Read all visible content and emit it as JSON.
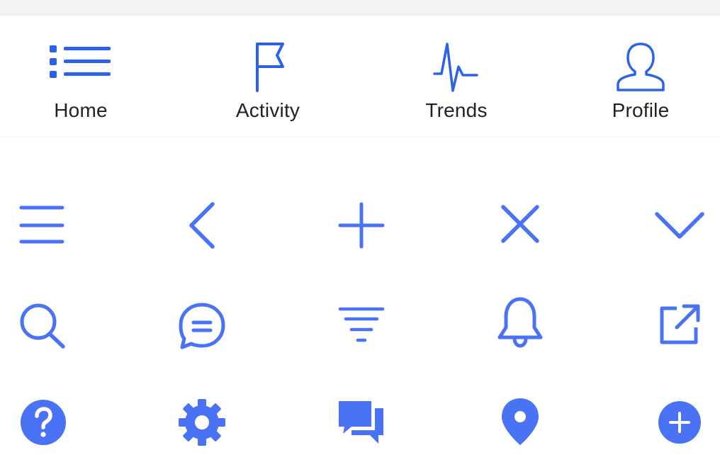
{
  "colors": {
    "accent": "#4a72f5",
    "tab_icon": "#2c63e6",
    "label": "#222222"
  },
  "tabbar": {
    "tabs": [
      {
        "label": "Home",
        "icon": "list-icon"
      },
      {
        "label": "Activity",
        "icon": "flag-icon"
      },
      {
        "label": "Trends",
        "icon": "pulse-icon"
      },
      {
        "label": "Profile",
        "icon": "user-icon"
      }
    ]
  },
  "icon_grid": {
    "rows": [
      [
        "menu-icon",
        "chevron-left-icon",
        "plus-icon",
        "close-icon",
        "chevron-down-icon"
      ],
      [
        "search-icon",
        "chat-bubble-icon",
        "filter-icon",
        "bell-icon",
        "external-link-icon"
      ],
      [
        "help-circle-icon",
        "gear-icon",
        "conversation-icon",
        "map-pin-icon",
        "add-circle-icon"
      ]
    ]
  }
}
